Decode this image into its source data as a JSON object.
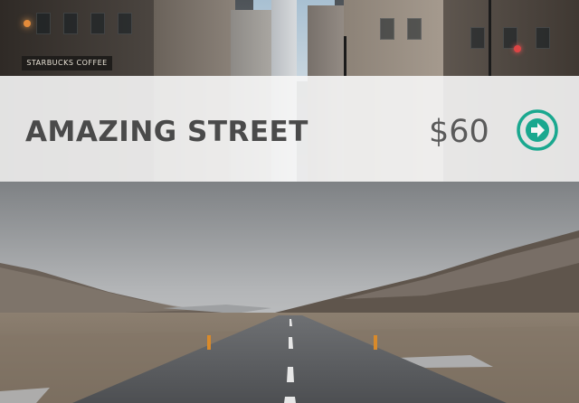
{
  "top_photo": {
    "storefront_sign": "STARBUCKS COFFEE"
  },
  "listing": {
    "title": "AMAZING STREET",
    "price": "$60",
    "action_icon": "arrow-right-circle-icon",
    "accent_color": "#1aa88f"
  },
  "bottom_photo": {
    "subject": "road-landscape"
  }
}
